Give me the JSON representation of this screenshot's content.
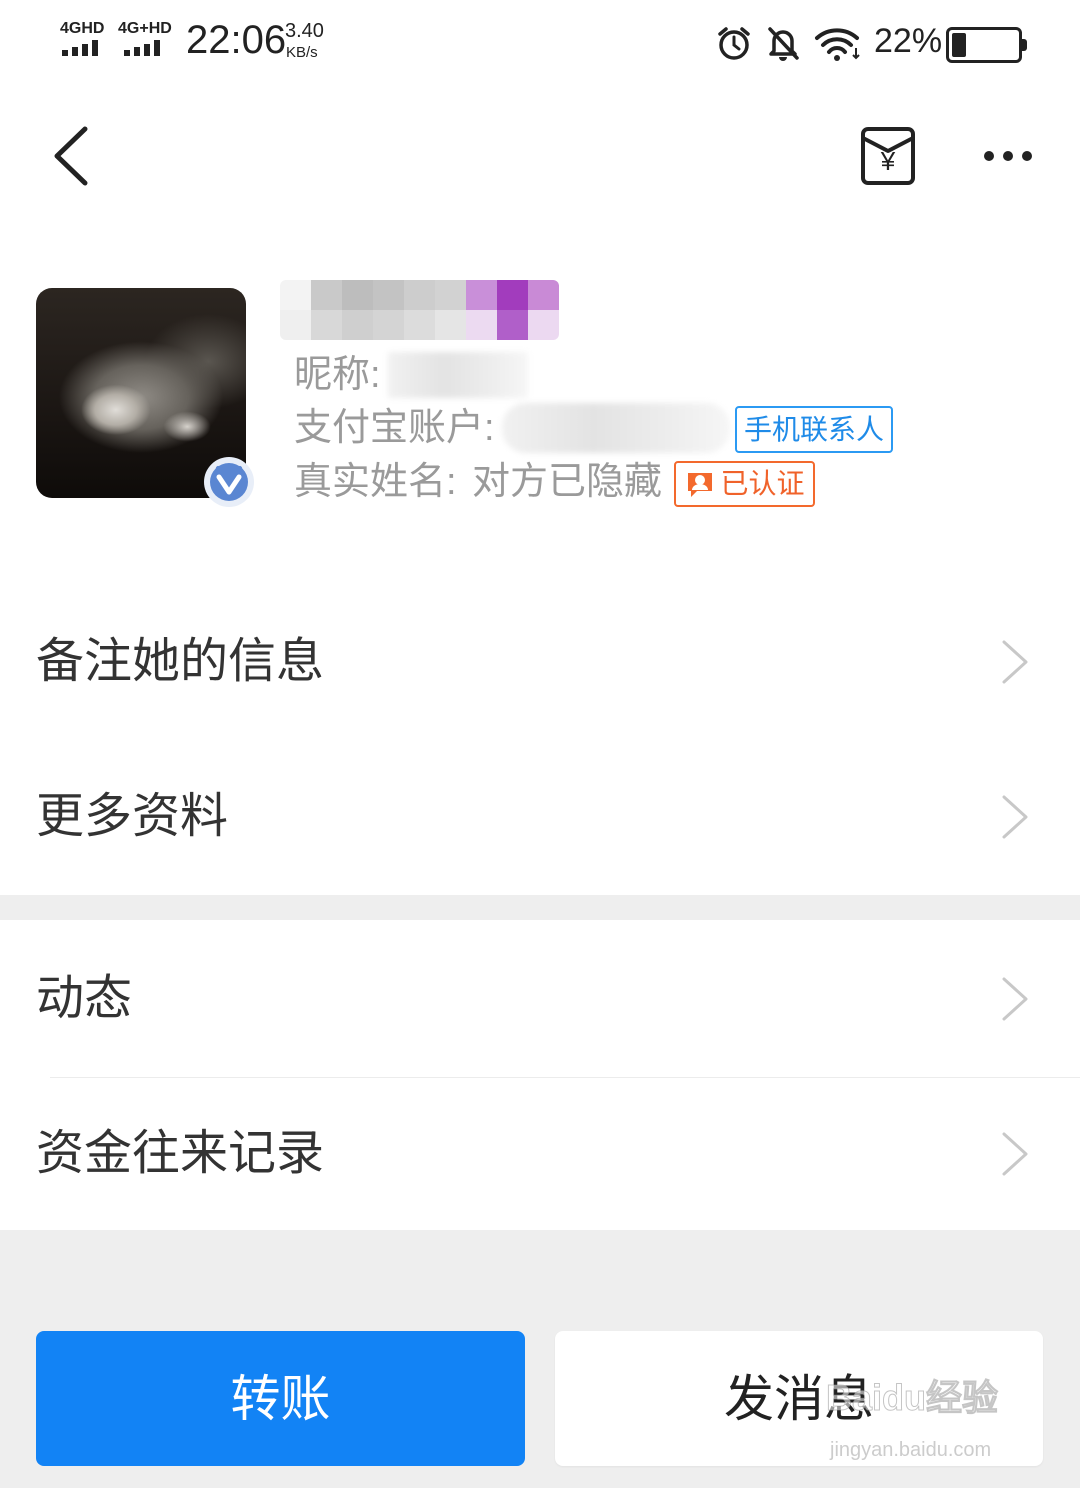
{
  "status_bar": {
    "network_1": "4GHD",
    "network_2": "4G+HD",
    "time": "22:06",
    "speed_value": "3.40",
    "speed_unit": "KB/s",
    "battery_text": "22%",
    "battery_level": 0.22,
    "icons": [
      "signal-icon",
      "alarm-icon",
      "bell-off-icon",
      "wifi-icon",
      "battery-icon"
    ]
  },
  "nav": {
    "back_icon": "back-chevron-icon",
    "red_packet_icon": "red-packet-icon",
    "red_packet_symbol": "¥",
    "more_icon": "more-dots-icon"
  },
  "profile": {
    "avatar_icon": "cat-photo-avatar",
    "verified_icon": "verified-badge-icon",
    "nickname_label": "昵称:",
    "account_label": "支付宝账户:",
    "contact_badge": "手机联系人",
    "realname_label": "真实姓名:",
    "realname_value": "对方已隐藏",
    "certified_icon": "certified-person-icon",
    "certified_badge": "已认证"
  },
  "menu": [
    {
      "label": "备注她的信息",
      "icon": "chevron-right-icon"
    },
    {
      "label": "更多资料",
      "icon": "chevron-right-icon"
    },
    {
      "label": "动态",
      "icon": "chevron-right-icon"
    },
    {
      "label": "资金往来记录",
      "icon": "chevron-right-icon"
    }
  ],
  "actions": {
    "transfer": "转账",
    "message": "发消息"
  },
  "watermark": {
    "brand": "Baidu经验",
    "url": "jingyan.baidu.com"
  },
  "colors": {
    "primary_blue": "#1283F5",
    "contact_badge_blue": "#2B9AF3",
    "certified_orange": "#F3692D",
    "verified_blue": "#5A86D2",
    "page_gray": "#EEEEEE"
  }
}
